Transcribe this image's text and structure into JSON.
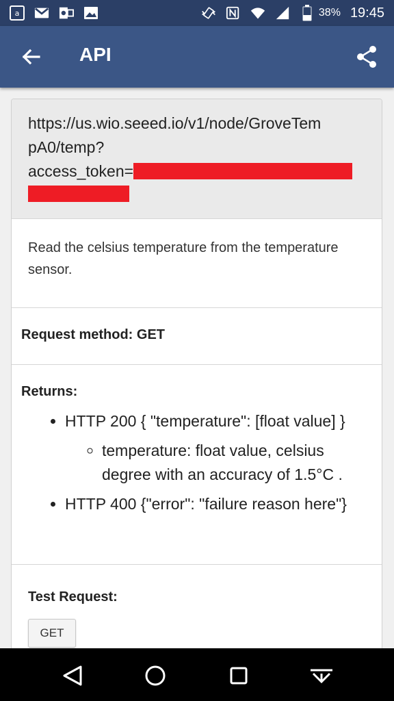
{
  "status_bar": {
    "left_icons": [
      "amazon-icon",
      "gmail-icon",
      "outlook-icon",
      "gallery-icon"
    ],
    "right_icons": [
      "vibrate-icon",
      "nfc-icon",
      "wifi-icon",
      "signal-icon",
      "battery-icon"
    ],
    "battery_percent": "38%",
    "time": "19:45"
  },
  "app_bar": {
    "title": "API",
    "back_icon": "arrow-back-icon",
    "share_icon": "share-icon"
  },
  "api": {
    "url_line1": "https://us.wio.seeed.io/v1/node/GroveTem",
    "url_line2": "pA0/temp?",
    "url_line3_prefix": "access_token=",
    "description": "Read the celsius temperature from the temperature sensor.",
    "method_label": "Request method: GET",
    "returns_label": "Returns:",
    "returns": {
      "item1": "HTTP 200 { \"temperature\": [float value] }",
      "item1_sub": "temperature: float value, celsius degree with an accuracy of 1.5°C .",
      "item2": "HTTP 400 {\"error\": \"failure reason here\"}"
    },
    "test_label": "Test Request:",
    "test_button": "GET"
  },
  "colors": {
    "status_bar": "#2b3f66",
    "app_bar": "#3b5686",
    "redaction": "#ee1c25"
  },
  "nav_bar": {
    "icons": [
      "back-triangle-icon",
      "home-circle-icon",
      "recents-square-icon",
      "hide-keyboard-icon"
    ]
  }
}
